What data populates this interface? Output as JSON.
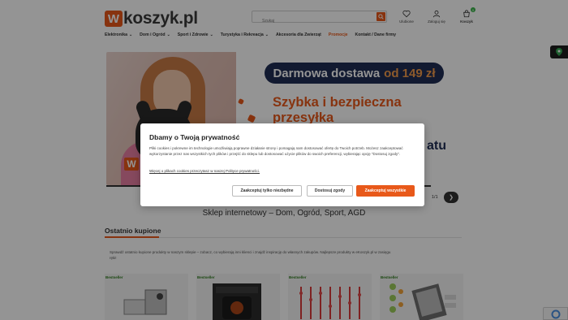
{
  "header": {
    "logo_mark": "W",
    "logo_text": "koszyk.pl",
    "search_placeholder": "Szukaj",
    "icons": [
      {
        "label": "Ulubione",
        "icon": "heart-icon"
      },
      {
        "label": "Zaloguj się",
        "icon": "user-icon"
      },
      {
        "label": "Koszyk",
        "icon": "cart-icon",
        "badge": "0"
      }
    ]
  },
  "nav": {
    "items": [
      {
        "label": "Elektronika",
        "dropdown": true
      },
      {
        "label": "Dom i Ogród",
        "dropdown": true
      },
      {
        "label": "Sport i Zdrowie",
        "dropdown": true
      },
      {
        "label": "Turystyka i Rekreacja",
        "dropdown": true
      },
      {
        "label": "Akcesoria dla Zwierząt",
        "dropdown": false
      },
      {
        "label": "Promocje",
        "dropdown": false,
        "highlight": true
      },
      {
        "label": "Kontakt / Dane firmy",
        "dropdown": false
      }
    ]
  },
  "banner": {
    "logo_mark": "W",
    "free_delivery": "Darmowa dostawa",
    "free_delivery_amount": "od 149 zł",
    "line1": "Szybka i bezpieczna",
    "line2": "przesyłka",
    "line3": "atu",
    "slide_counter": "1/1",
    "next_arrow": "❯"
  },
  "store_title": "Sklep internetowy – Dom, Ogród, Sport, AGD",
  "recent": {
    "heading": "Ostatnio kupione",
    "description": "Sprawdź ostatnio kupione produkty w naszym sklepie – zobacz, co wybierają inni klienci i znajdź inspirację do własnych zakupów. Najlepsze produkty w eKoszyk.pl w zasięgu ręki!",
    "products": [
      {
        "badge": "Bestseller"
      },
      {
        "badge": "Bestseller"
      },
      {
        "badge": "Bestseller"
      },
      {
        "badge": "Bestseller"
      }
    ]
  },
  "cookie_modal": {
    "title": "Dbamy o Twoją prywatność",
    "text": "Pliki cookies i pokrewne im technologie umożliwiają poprawne działanie strony i pomagają nam dostosować ofertę do Twoich potrzeb. Możesz zaakceptować wykorzystanie przez nas wszystkich tych plików i przejść do sklepu lub dostosować użycie plików do swoich preferencji, wybierając opcję \"Dostosuj zgody\".",
    "link": "Więcej o plikach cookies przeczytasz w naszej Polityce prywatności.",
    "btn_necessary": "Zaakceptuj tylko niezbędne",
    "btn_customize": "Dostosuj zgody",
    "btn_accept_all": "Zaakceptuj wszystkie"
  },
  "colors": {
    "accent": "#e8591a",
    "navy": "#1f2e55",
    "badge_green": "#3cb54a",
    "bestseller_green": "#2f7d1f"
  }
}
